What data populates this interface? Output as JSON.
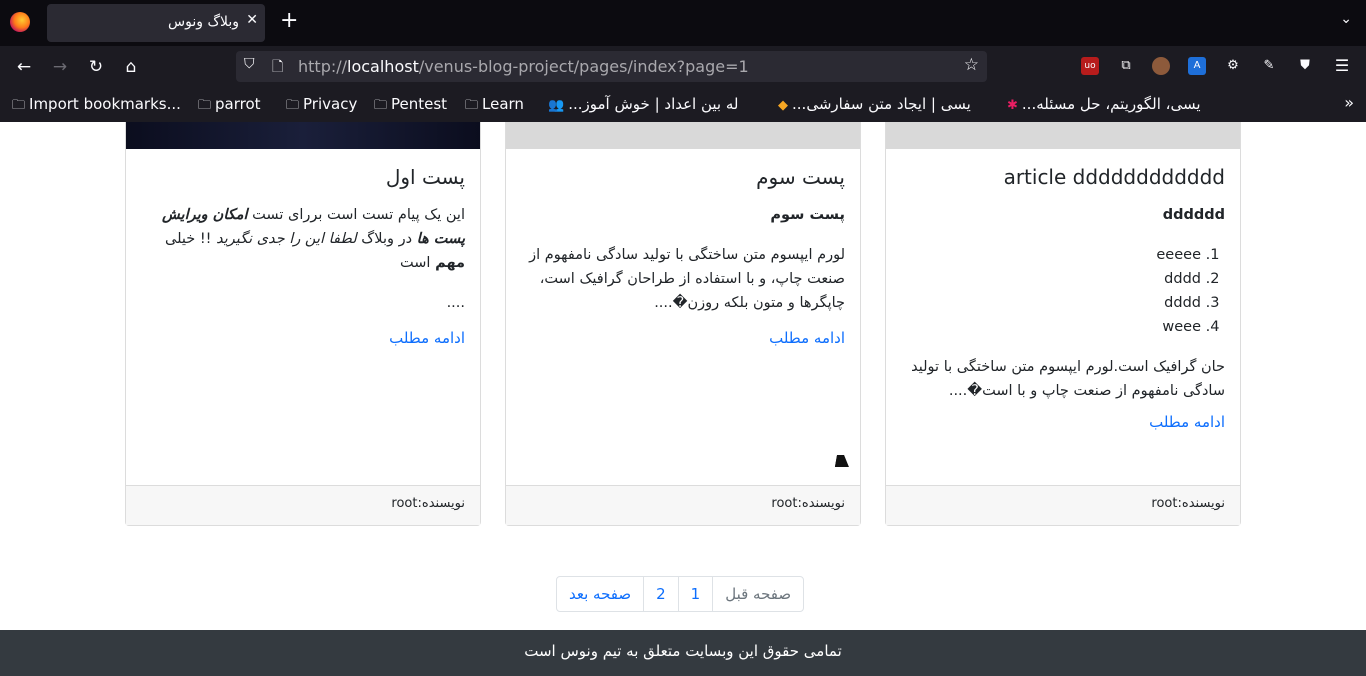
{
  "browser": {
    "tab_title": "وبلاگ ونوس",
    "tab_close": "✕",
    "new_tab": "+",
    "url_scheme": "http://",
    "url_host": "localhost",
    "url_path": "/venus-blog-project/pages/index?page=1",
    "bookmarks": [
      {
        "icon": "🗀",
        "label": "Import bookmarks..."
      },
      {
        "icon": "🗀",
        "label": "parrot"
      },
      {
        "icon": "🗀",
        "label": "Privacy"
      },
      {
        "icon": "🗀",
        "label": "Pentest"
      },
      {
        "icon": "🗀",
        "label": "Learn"
      },
      {
        "icon": "👥",
        "label": "...له بین اعداد | خوش آموز"
      },
      {
        "icon": "◆",
        "label": "...یسی | ایجاد متن سفارشی"
      },
      {
        "icon": "✱",
        "label": "...یسی، الگوریتم، حل مسئله"
      }
    ]
  },
  "cards": [
    {
      "title": "article dddddddddddd",
      "bold_line": "dddddd",
      "list": [
        "eeeee",
        "dddd",
        "dddd",
        "weee"
      ],
      "excerpt": "حان گرافیک است.لورم ایپسوم متن ساختگی با تولید سادگی نامفهوم از صنعت چاپ و با است�....",
      "read_more": "ادامه مطلب",
      "author": "نویسنده:root",
      "image_color": "#d9d9d9"
    },
    {
      "title": "پست سوم",
      "bold_line": "پست سوم",
      "excerpt": "لورم ایپسوم متن ساختگی با تولید سادگی نامفهوم از صنعت چاپ، و با استفاده از طراحان گرافیک است، چاپگرها و متون بلکه روزن�....",
      "read_more": "ادامه مطلب",
      "author": "نویسنده:root",
      "image_color": "#d9d9d9"
    },
    {
      "title": "پست اول",
      "text_a": "این یک پیام تست است بررای تست ",
      "text_b": "امکان ویرایش پست ها",
      "text_c": " در وبلاگ ",
      "text_d": "لطفا این را جدی نگیرید",
      "text_e": " !! خیلی ",
      "text_f": "مهم",
      "text_g": " است",
      "dots": "....",
      "read_more": "ادامه مطلب",
      "author": "نویسنده:root",
      "image_color": "#0f1226"
    }
  ],
  "pagination": {
    "prev": "صفحه قبل",
    "pages": [
      "1",
      "2"
    ],
    "next": "صفحه بعد"
  },
  "footer": "تمامی حقوق این وبسایت متعلق به تیم ونوس است"
}
